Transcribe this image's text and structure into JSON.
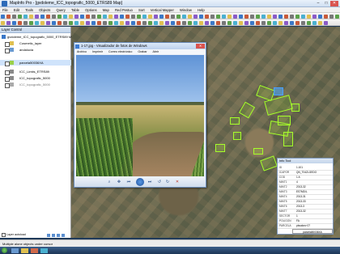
{
  "window": {
    "title": "MapInfo Pro - [gvdoleme_ICC_topografic_5000_ETRS89 Map]",
    "minimize": "–",
    "maximize": "□",
    "close": "✕"
  },
  "menu": {
    "items": [
      "File",
      "Edit",
      "Tools",
      "Objects",
      "Query",
      "Table",
      "Options",
      "Map",
      "Red Pestuo",
      "Sort",
      "Vertical Mapper",
      "Window",
      "Help"
    ]
  },
  "layer_control": {
    "title": "Layer Control",
    "rows": [
      {
        "label": "gvdoleme_ICC_topografic_5000_ETRS89 Map"
      },
      {
        "label": "Cosmetic_layer"
      },
      {
        "label": "andalucia"
      },
      {
        "label": "parcela50036XA"
      },
      {
        "label": "ICC_Limits_ETRS89"
      },
      {
        "label": "ICC_topografic_5000"
      },
      {
        "label": "ICC_topografic_5000"
      }
    ],
    "auto_label": "Layer autoload"
  },
  "photo_viewer": {
    "title": "1-17.jpg - Visualizador de fotos de Windows",
    "menu": [
      "Archivo",
      "Imprimir",
      "Correo electrónico",
      "Grabar",
      "Abrir"
    ]
  },
  "info_tool": {
    "title": "Info Tool",
    "rows": [
      {
        "k": "ID",
        "v": "1.101"
      },
      {
        "k": "ICAPOR",
        "v": "QN_T04ZLGEDO"
      },
      {
        "k": "COD",
        "v": "1 A"
      },
      {
        "k": "MINT1",
        "v": "4"
      },
      {
        "k": "MINT2",
        "v": "2013-32"
      },
      {
        "k": "MINT3",
        "v": "ES7MD/L"
      },
      {
        "k": "MINT4",
        "v": "2013-31"
      },
      {
        "k": "MINT5",
        "v": "2013-33"
      },
      {
        "k": "MINT6",
        "v": "2013-3"
      },
      {
        "k": "MINT7",
        "v": "2013-32"
      },
      {
        "k": "SECTOR",
        "v": "1"
      },
      {
        "k": "POLIGON",
        "v": "FA"
      },
      {
        "k": "PARCELA",
        "v": "pbcalcnv 07"
      }
    ],
    "footer": "parcela50036XA"
  },
  "status": {
    "text": "Multiple alone objects under cursor"
  },
  "colors": {
    "polygon_outline": "#a6ff2a",
    "titlebar": "#cfdff2"
  }
}
